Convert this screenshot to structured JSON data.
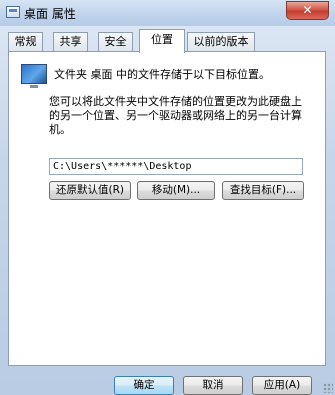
{
  "window": {
    "title": "桌面 属性",
    "close_label": "✕"
  },
  "tabs": [
    {
      "label": "常规"
    },
    {
      "label": "共享"
    },
    {
      "label": "安全"
    },
    {
      "label": "位置",
      "active": true
    },
    {
      "label": "以前的版本"
    }
  ],
  "location": {
    "header": "文件夹 桌面 中的文件存储于以下目标位置。",
    "description": "您可以将此文件夹中文件存储的位置更改为此硬盘上的另一个位置、另一个驱动器或网络上的另一台计算机。",
    "path_value": "C:\\Users\\******\\Desktop",
    "restore_default_label": "还原默认值(R)",
    "move_label": "移动(M)...",
    "find_target_label": "查找目标(F)..."
  },
  "footer": {
    "ok_label": "确定",
    "cancel_label": "取消",
    "apply_label": "应用(A)"
  }
}
